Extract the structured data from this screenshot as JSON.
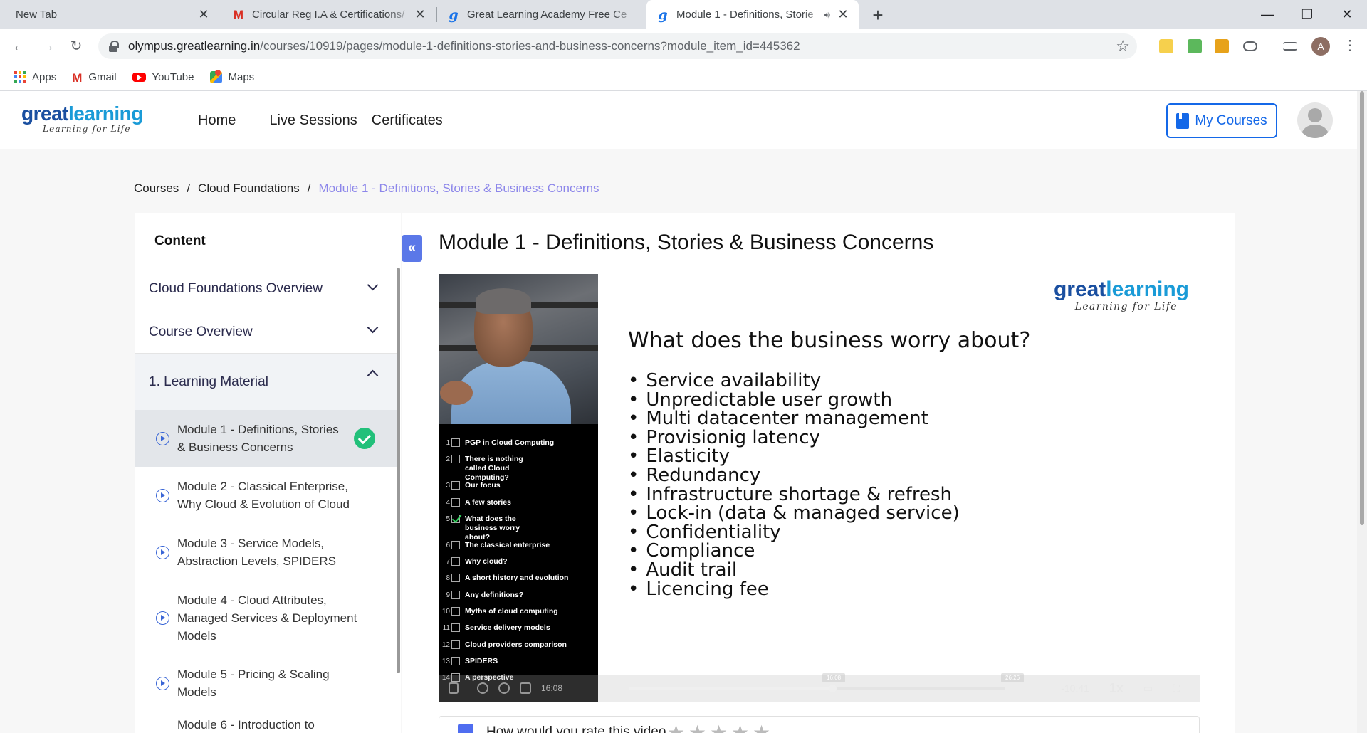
{
  "browser": {
    "tabs": [
      {
        "title": "New Tab",
        "favicon": "none",
        "active": false
      },
      {
        "title": "Circular Reg I.A & Certifications/",
        "favicon": "gmail-icon",
        "active": false
      },
      {
        "title": "Great Learning Academy Free Ce",
        "favicon": "greatlearning-icon",
        "active": false
      },
      {
        "title": "Module 1 - Definitions, Storie",
        "favicon": "greatlearning-icon",
        "active": true
      }
    ],
    "url_host": "olympus.greatlearning.in",
    "url_path": "/courses/10919/pages/module-1-definitions-stories-and-business-concerns?module_item_id=445362",
    "profile_initial": "A",
    "bookmarks": [
      "Apps",
      "Gmail",
      "YouTube",
      "Maps"
    ]
  },
  "header": {
    "logo_great": "great",
    "logo_learning": "learning",
    "logo_tagline": "Learning for Life",
    "nav": [
      "Home",
      "Live Sessions",
      "Certificates"
    ],
    "my_courses": "My Courses"
  },
  "breadcrumb": {
    "items": [
      "Courses",
      "Cloud Foundations"
    ],
    "current": "Module 1 - Definitions, Stories & Business Concerns",
    "separator": "/"
  },
  "sidebar": {
    "title": "Content",
    "sections": [
      {
        "label": "Cloud Foundations Overview",
        "expanded": false
      },
      {
        "label": "Course Overview",
        "expanded": false
      },
      {
        "label": "1. Learning Material",
        "expanded": true
      }
    ],
    "modules": [
      {
        "line1": "Module 1 - Definitions, Stories",
        "line2": "& Business Concerns",
        "line3": "",
        "active": true,
        "completed": true
      },
      {
        "line1": "Module 2 - Classical Enterprise,",
        "line2": "Why Cloud & Evolution of Cloud",
        "line3": "",
        "active": false,
        "completed": false
      },
      {
        "line1": "Module 3 - Service Models,",
        "line2": "Abstraction Levels, SPIDERS",
        "line3": "",
        "active": false,
        "completed": false
      },
      {
        "line1": "Module 4 - Cloud Attributes,",
        "line2": "Managed Services & Deployment",
        "line3": "Models",
        "active": false,
        "completed": false
      },
      {
        "line1": "Module 5 - Pricing & Scaling",
        "line2": "Models",
        "line3": "",
        "active": false,
        "completed": false
      },
      {
        "line1": "Module 6 - Introduction to",
        "line2": "",
        "line3": "",
        "active": false,
        "completed": false
      }
    ]
  },
  "main": {
    "title": "Module 1 - Definitions, Stories & Business Concerns",
    "rate_prompt": "How would you rate this video"
  },
  "video": {
    "agenda": [
      {
        "num": "1",
        "text": "PGP in Cloud Computing",
        "checked": false
      },
      {
        "num": "2",
        "text": "There is nothing called Cloud Computing?",
        "checked": false
      },
      {
        "num": "3",
        "text": "Our focus",
        "checked": false
      },
      {
        "num": "4",
        "text": "A few stories",
        "checked": false
      },
      {
        "num": "5",
        "text": "What does the business worry about?",
        "checked": true
      },
      {
        "num": "6",
        "text": "The classical enterprise",
        "checked": false
      },
      {
        "num": "7",
        "text": "Why cloud?",
        "checked": false
      },
      {
        "num": "8",
        "text": "A short history and evolution",
        "checked": false
      },
      {
        "num": "9",
        "text": "Any definitions?",
        "checked": false
      },
      {
        "num": "10",
        "text": "Myths of cloud computing",
        "checked": false
      },
      {
        "num": "11",
        "text": "Service delivery models",
        "checked": false
      },
      {
        "num": "12",
        "text": "Cloud providers comparison",
        "checked": false
      },
      {
        "num": "13",
        "text": "SPIDERS",
        "checked": false
      },
      {
        "num": "14",
        "text": "A perspective",
        "checked": false
      }
    ],
    "slide_logo_great": "great",
    "slide_logo_learning": "learning",
    "slide_logo_tagline": "Learning for Life",
    "slide_heading": "What does the business worry about?",
    "slide_bullets": [
      "Service availability",
      "Unpredictable user growth",
      "Multi datacenter management",
      "Provisionig latency",
      "Elasticity",
      "Redundancy",
      "Infrastructure shortage & refresh",
      "Lock-in (data & managed service)",
      "Confidentiality",
      "Compliance",
      "Audit trail",
      "Licencing fee"
    ],
    "slide_page": "5",
    "elapsed": "16:08",
    "remaining": "-10:41",
    "hover_time_1": "16:08",
    "hover_time_2": "26:26",
    "progress_fraction": 0.54,
    "speed": "1x"
  },
  "colors": {
    "brand_blue": "#1468e8",
    "breadcrumb_current": "#8c86ea",
    "completed_green": "#22c07a",
    "collapse_button": "#5b78e8"
  }
}
